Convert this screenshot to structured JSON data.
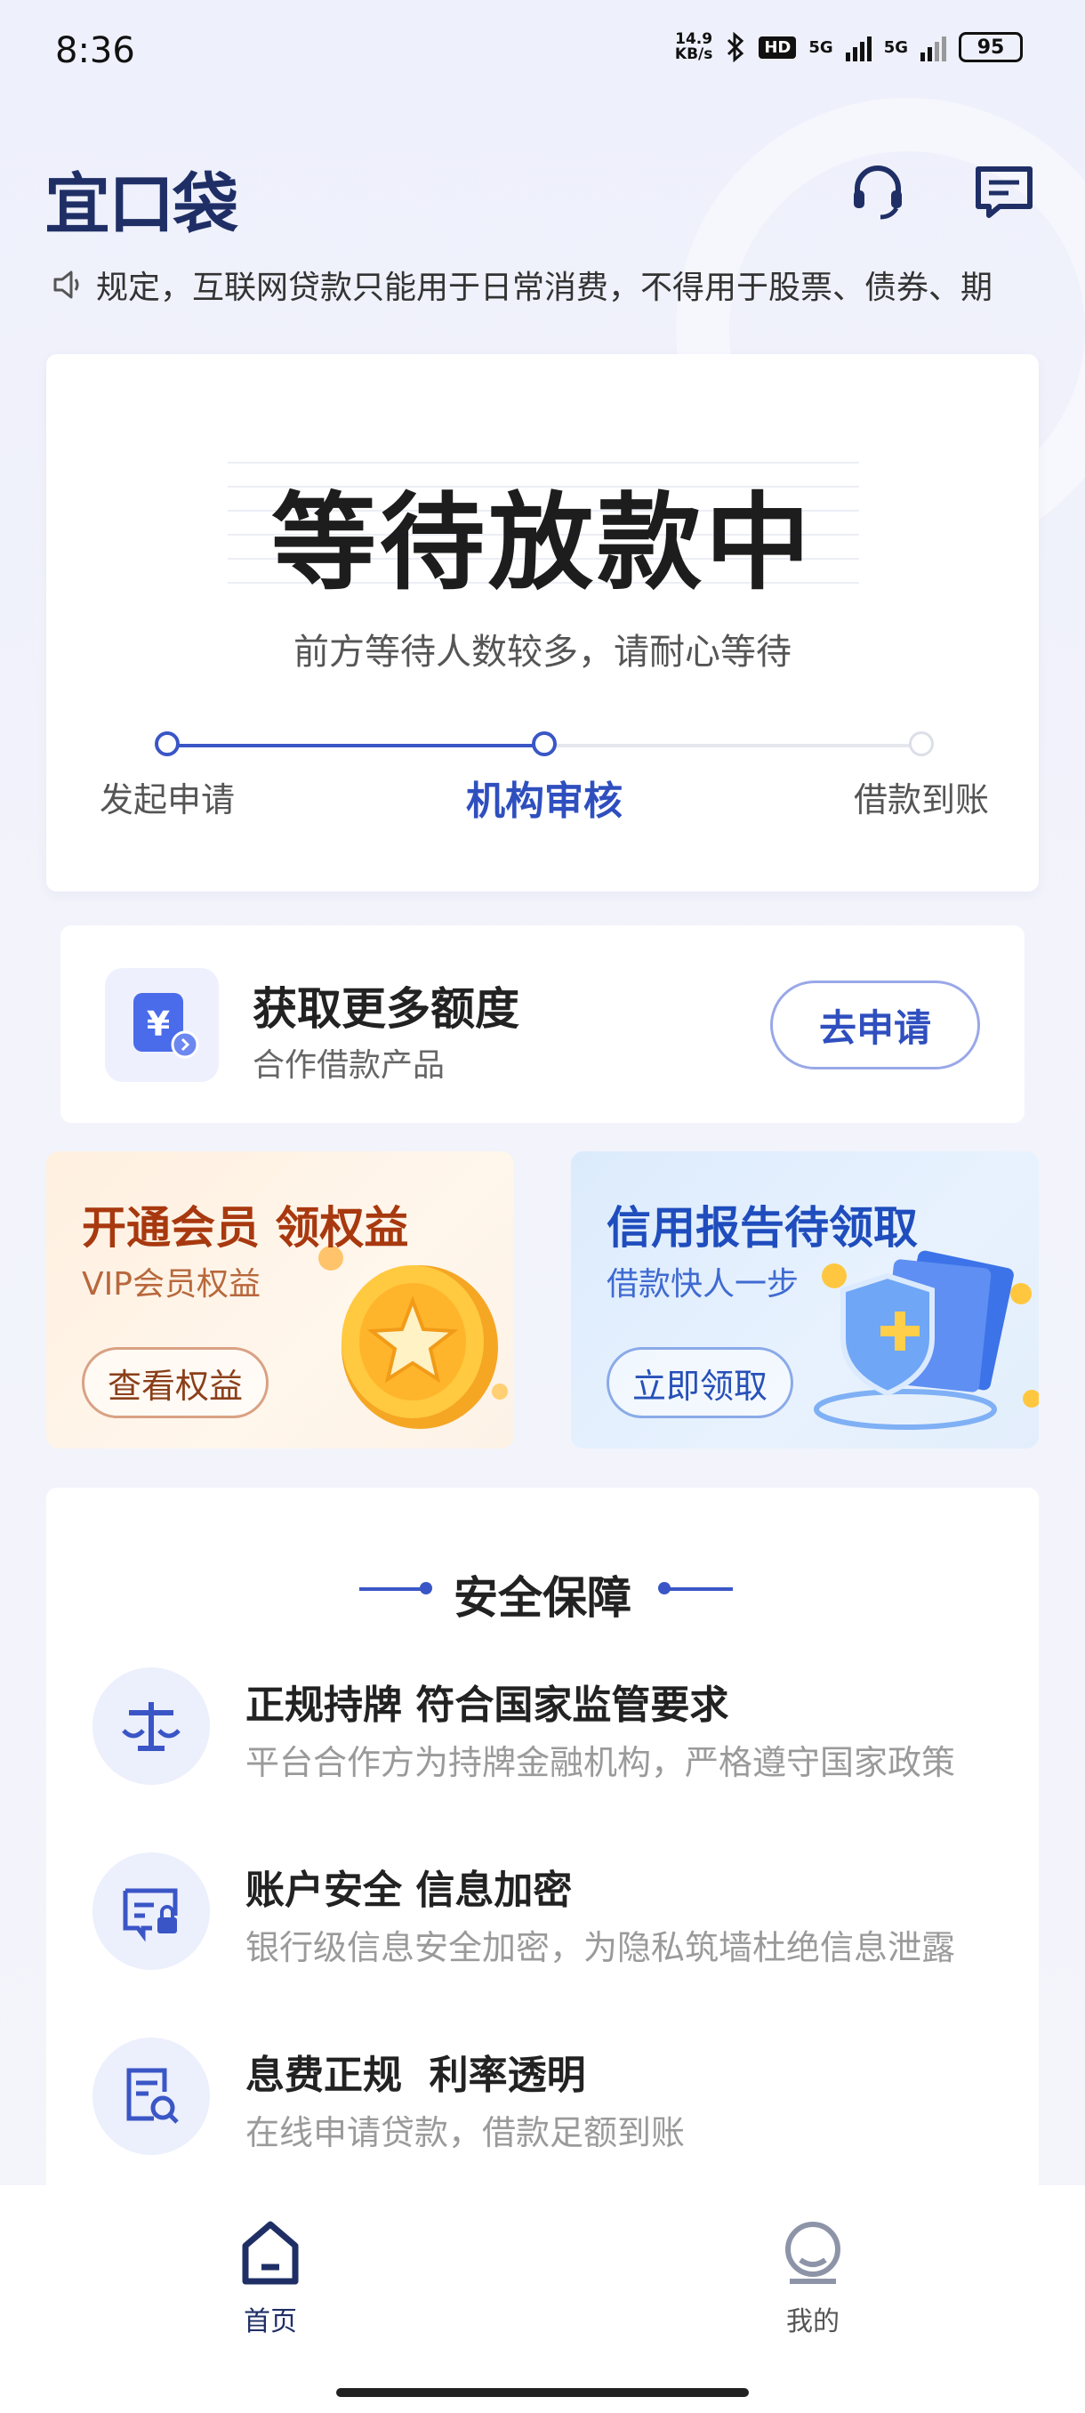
{
  "status_bar": {
    "time": "8:36",
    "net_speed_top": "14.9",
    "net_speed_bottom": "KB/s",
    "hd_badge": "HD",
    "signal_1": "5G",
    "signal_2": "5G",
    "battery": "95"
  },
  "header": {
    "logo": "宜口袋",
    "icons": [
      "headset-icon",
      "message-icon"
    ]
  },
  "notice": {
    "text": "规定，互联网贷款只能用于日常消费，不得用于股票、债券、期"
  },
  "loan_status": {
    "title": "等待放款中",
    "subtitle": "前方等待人数较多，请耐心等待",
    "steps": [
      {
        "label": "发起申请",
        "state": "done"
      },
      {
        "label": "机构审核",
        "state": "active"
      },
      {
        "label": "借款到账",
        "state": "pending"
      }
    ],
    "progress_fraction": 0.5
  },
  "quota": {
    "title": "获取更多额度",
    "subtitle": "合作借款产品",
    "button": "去申请",
    "icon": "yuan-wallet-icon"
  },
  "promos": [
    {
      "title": "开通会员 领权益",
      "subtitle": "VIP会员权益",
      "button": "查看权益",
      "icon": "gold-star-coin-icon"
    },
    {
      "title": "信用报告待领取",
      "subtitle": "借款快人一步",
      "button": "立即领取",
      "icon": "shield-report-icon"
    }
  ],
  "safety": {
    "title": "安全保障",
    "items": [
      {
        "title": "正规持牌 符合国家监管要求",
        "desc": "平台合作方为持牌金融机构，严格遵守国家政策",
        "icon": "balance-scale-icon"
      },
      {
        "title": "账户安全 信息加密",
        "desc": "银行级信息安全加密，为隐私筑墙杜绝信息泄露",
        "icon": "id-card-lock-icon"
      },
      {
        "title": "息费正规  利率透明",
        "desc": "在线申请贷款，借款足额到账",
        "icon": "document-search-icon"
      }
    ]
  },
  "bottom_nav": [
    {
      "label": "首页",
      "icon": "home-icon",
      "active": true
    },
    {
      "label": "我的",
      "icon": "profile-icon",
      "active": false
    }
  ],
  "colors": {
    "brand": "#1f2f66",
    "accent": "#3a56c6",
    "vip": "#a8390f",
    "credit": "#1f4dbd"
  }
}
